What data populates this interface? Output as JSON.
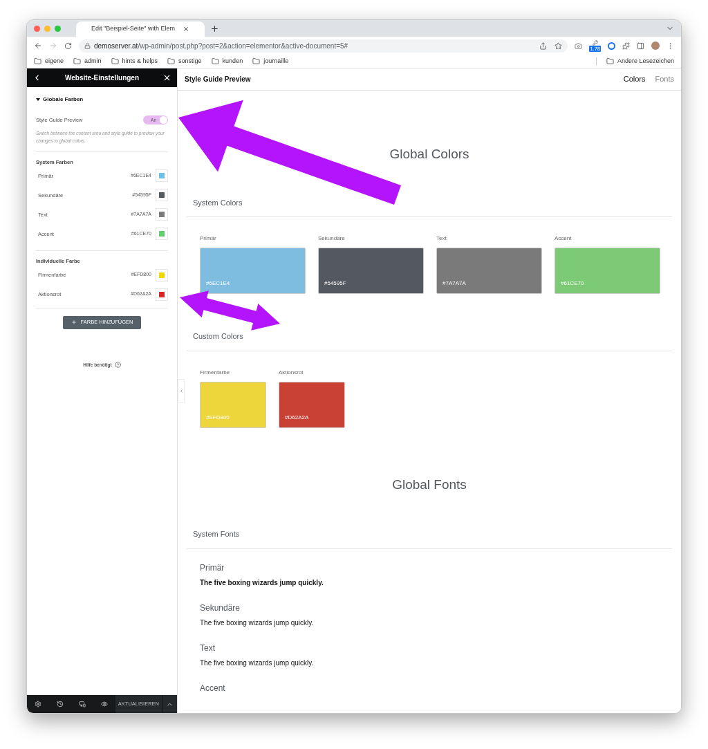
{
  "browser": {
    "tab_title": "Edit \"Beispiel-Seite\" with Elem",
    "url_host": "demoserver.at",
    "url_path": "/wp-admin/post.php?post=2&action=elementor&active-document=5#",
    "extension_badge": "1.78",
    "bookmarks": [
      "eigene",
      "admin",
      "hints & helps",
      "sonstige",
      "kunden",
      "journaille"
    ],
    "other_bookmarks": "Andere Lesezeichen"
  },
  "sidebar": {
    "title": "Website-Einstellungen",
    "section": {
      "title": "Globale Farben",
      "expanded": true
    },
    "preview_toggle": {
      "label": "Style Guide Preview",
      "on": true,
      "state_label": "An"
    },
    "description": "Switch between the content area and style guide to preview your changes to global colors.",
    "groups": [
      {
        "title": "System Farben",
        "colors": [
          {
            "name": "Primär",
            "hex": "#6EC1E4",
            "color": "#6ec1e4"
          },
          {
            "name": "Sekundäre",
            "hex": "#54595F",
            "color": "#54595f"
          },
          {
            "name": "Text",
            "hex": "#7A7A7A",
            "color": "#7a7a7a"
          },
          {
            "name": "Accent",
            "hex": "#61CE70",
            "color": "#61ce70"
          }
        ]
      },
      {
        "title": "Individuelle Farbe",
        "colors": [
          {
            "name": "Firmenfarbe",
            "hex": "#EFD800",
            "color": "#efd800"
          },
          {
            "name": "Aktionsrot",
            "hex": "#D62A2A",
            "color": "#d62a2a"
          }
        ]
      }
    ],
    "add_button": "FARBE HINZUFÜGEN",
    "help": "Hilfe benötigt",
    "footer_button": "AKTUALISIEREN"
  },
  "preview": {
    "title": "Style Guide Preview",
    "nav": [
      {
        "label": "Colors",
        "selected": true
      },
      {
        "label": "Fonts",
        "selected": false
      }
    ],
    "colors_heading": "Global Colors",
    "color_groups": [
      {
        "title": "System Colors",
        "swatches": [
          {
            "name": "Primär",
            "hex": "#6EC1E4",
            "color": "#7fbde0"
          },
          {
            "name": "Sekundäre",
            "hex": "#54595F",
            "color": "#54585f"
          },
          {
            "name": "Text",
            "hex": "#7A7A7A",
            "color": "#7a7a7a"
          },
          {
            "name": "Accent",
            "hex": "#61CE70",
            "color": "#7cca75"
          }
        ]
      },
      {
        "title": "Custom Colors",
        "swatches": [
          {
            "name": "Firmenfarbe",
            "hex": "#EFD800",
            "color": "#edd63b"
          },
          {
            "name": "Aktionsrot",
            "hex": "#D62A2A",
            "color": "#c94034"
          }
        ]
      }
    ],
    "fonts_heading": "Global Fonts",
    "fonts_group": "System Fonts",
    "fonts": [
      {
        "name": "Primär",
        "sample": "The five boxing wizards jump quickly.",
        "bold": true
      },
      {
        "name": "Sekundäre",
        "sample": "The five boxing wizards jump quickly.",
        "bold": false
      },
      {
        "name": "Text",
        "sample": "The five boxing wizards jump quickly.",
        "bold": false
      },
      {
        "name": "Accent"
      }
    ]
  }
}
